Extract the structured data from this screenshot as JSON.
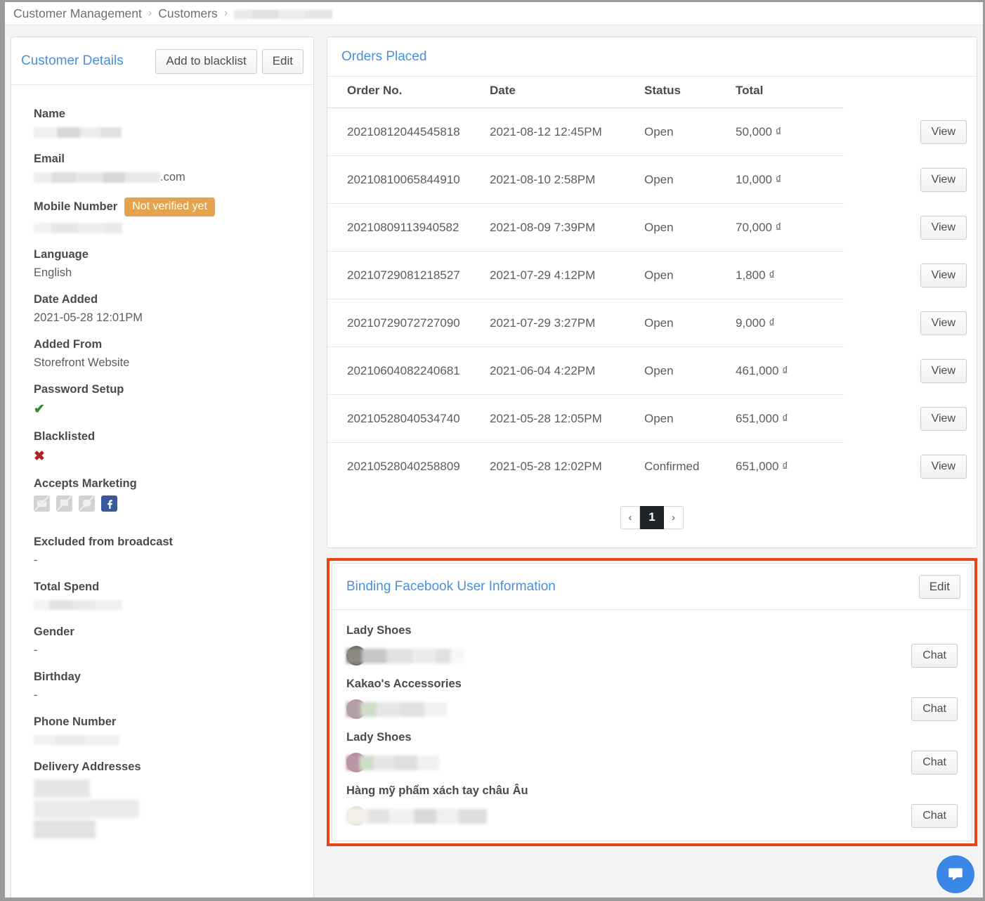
{
  "breadcrumb": {
    "items": [
      "Customer Management",
      "Customers"
    ],
    "separator": "›",
    "redacted_item": ""
  },
  "customer_panel": {
    "title": "Customer Details",
    "blacklist_button": "Add to blacklist",
    "edit_button": "Edit",
    "fields": {
      "name_label": "Name",
      "name_value": "",
      "email_label": "Email",
      "email_suffix": ".com",
      "mobile_label": "Mobile Number",
      "mobile_badge": "Not verified yet",
      "mobile_value": "",
      "language_label": "Language",
      "language_value": "English",
      "date_added_label": "Date Added",
      "date_added_value": "2021-05-28 12:01PM",
      "added_from_label": "Added From",
      "added_from_value": "Storefront Website",
      "password_setup_label": "Password Setup",
      "password_setup_value": "✔",
      "blacklisted_label": "Blacklisted",
      "blacklisted_value": "✖",
      "accepts_marketing_label": "Accepts Marketing",
      "excluded_label": "Excluded from broadcast",
      "excluded_value": "-",
      "total_spend_label": "Total Spend",
      "total_spend_value": "",
      "gender_label": "Gender",
      "gender_value": "-",
      "birthday_label": "Birthday",
      "birthday_value": "-",
      "phone_label": "Phone Number",
      "phone_value": "",
      "delivery_label": "Delivery Addresses"
    },
    "marketing_channels": [
      {
        "name": "email-marketing-icon",
        "enabled": false
      },
      {
        "name": "sms-marketing-icon",
        "enabled": false
      },
      {
        "name": "line-marketing-icon",
        "enabled": false
      },
      {
        "name": "facebook-marketing-icon",
        "enabled": true
      }
    ]
  },
  "orders_panel": {
    "title": "Orders Placed",
    "columns": [
      "Order No.",
      "Date",
      "Status",
      "Total"
    ],
    "action_label": "View",
    "rows": [
      {
        "order_no": "20210812044545818",
        "date": "2021-08-12 12:45PM",
        "status": "Open",
        "total": "50,000 ₫"
      },
      {
        "order_no": "20210810065844910",
        "date": "2021-08-10 2:58PM",
        "status": "Open",
        "total": "10,000 ₫"
      },
      {
        "order_no": "20210809113940582",
        "date": "2021-08-09 7:39PM",
        "status": "Open",
        "total": "70,000 ₫"
      },
      {
        "order_no": "20210729081218527",
        "date": "2021-07-29 4:12PM",
        "status": "Open",
        "total": "1,800 ₫"
      },
      {
        "order_no": "20210729072727090",
        "date": "2021-07-29 3:27PM",
        "status": "Open",
        "total": "9,000 ₫"
      },
      {
        "order_no": "20210604082240681",
        "date": "2021-06-04 4:22PM",
        "status": "Open",
        "total": "461,000 ₫"
      },
      {
        "order_no": "20210528040534740",
        "date": "2021-05-28 12:05PM",
        "status": "Open",
        "total": "651,000 ₫"
      },
      {
        "order_no": "20210528040258809",
        "date": "2021-05-28 12:02PM",
        "status": "Confirmed",
        "total": "651,000 ₫"
      }
    ],
    "pagination": {
      "prev": "‹",
      "current": "1",
      "next": "›"
    }
  },
  "binding_panel": {
    "title": "Binding Facebook User Information",
    "edit_button": "Edit",
    "chat_button": "Chat",
    "highlight_color": "#ea4517",
    "rows": [
      {
        "page_name": "Lady Shoes",
        "user_name": ""
      },
      {
        "page_name": "Kakao's Accessories",
        "user_name": ""
      },
      {
        "page_name": "Lady Shoes",
        "user_name": ""
      },
      {
        "page_name": "Hàng mỹ phẩm xách tay châu Âu",
        "user_name": ""
      }
    ]
  },
  "chat_launcher": {
    "name": "intercom-chat-launcher"
  },
  "colors": {
    "link": "#4a90d9",
    "badge_warning": "#e3a44d",
    "highlight": "#ea4517",
    "facebook": "#3b5998",
    "check": "#2e8b2e",
    "cross": "#b02020",
    "pagination_active": "#20242b",
    "launcher": "#3b87e8"
  }
}
